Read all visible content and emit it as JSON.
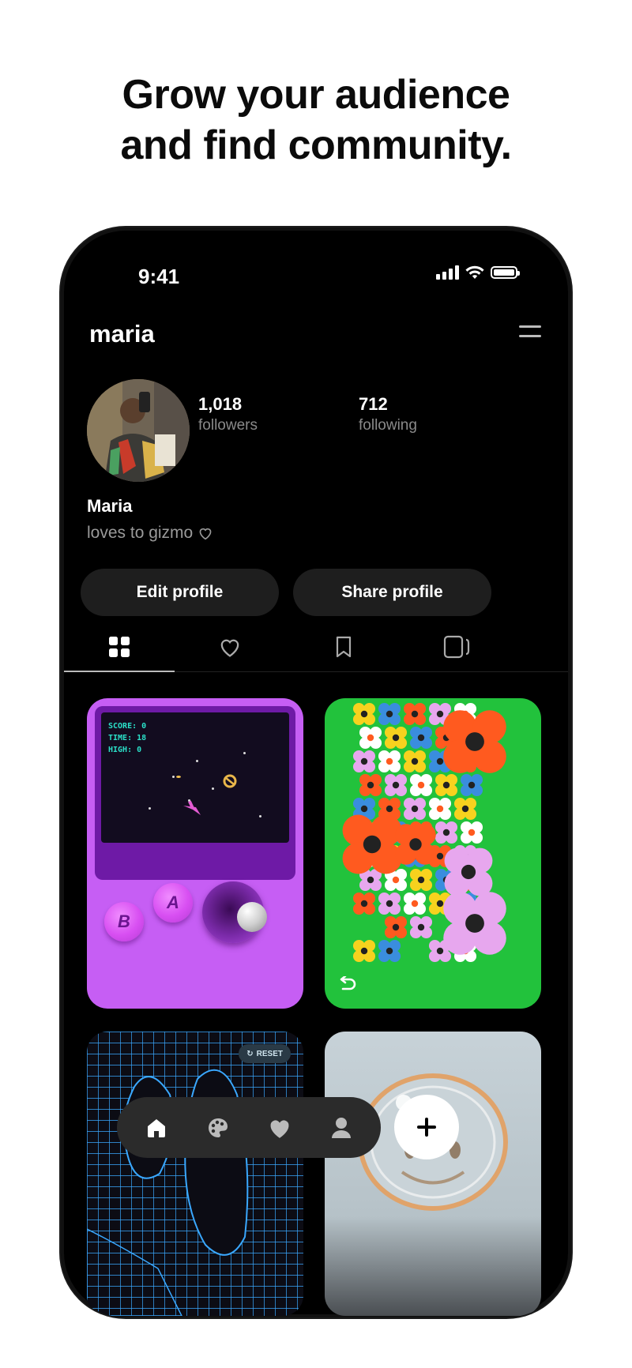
{
  "headline": {
    "line1": "Grow your audience",
    "line2": "and find community."
  },
  "status_bar": {
    "time": "9:41"
  },
  "profile": {
    "username": "maria",
    "followers_count": "1,018",
    "followers_label": "followers",
    "following_count": "712",
    "following_label": "following",
    "display_name": "Maria",
    "bio": "loves to gizmo"
  },
  "actions": {
    "edit_label": "Edit profile",
    "share_label": "Share profile"
  },
  "tabs": [
    {
      "icon": "grid-icon",
      "active": true
    },
    {
      "icon": "heart-outline-icon",
      "active": false
    },
    {
      "icon": "bookmark-icon",
      "active": false
    },
    {
      "icon": "cards-icon",
      "active": false
    }
  ],
  "cards": {
    "game": {
      "score_lines": [
        "SCORE: 0",
        "TIME: 18",
        "HIGH: 0"
      ],
      "button_b": "B",
      "button_a": "A"
    },
    "grid_reset_label": "RESET"
  },
  "bottom_nav": [
    "home-icon",
    "palette-icon",
    "heart-icon",
    "profile-icon",
    "plus-icon"
  ],
  "colors": {
    "background": "#000000",
    "surface": "#1e1e1e",
    "text": "#ffffff",
    "muted": "#8a8a8a",
    "purple_card": "#c65ef4",
    "green_card": "#22c23c"
  }
}
